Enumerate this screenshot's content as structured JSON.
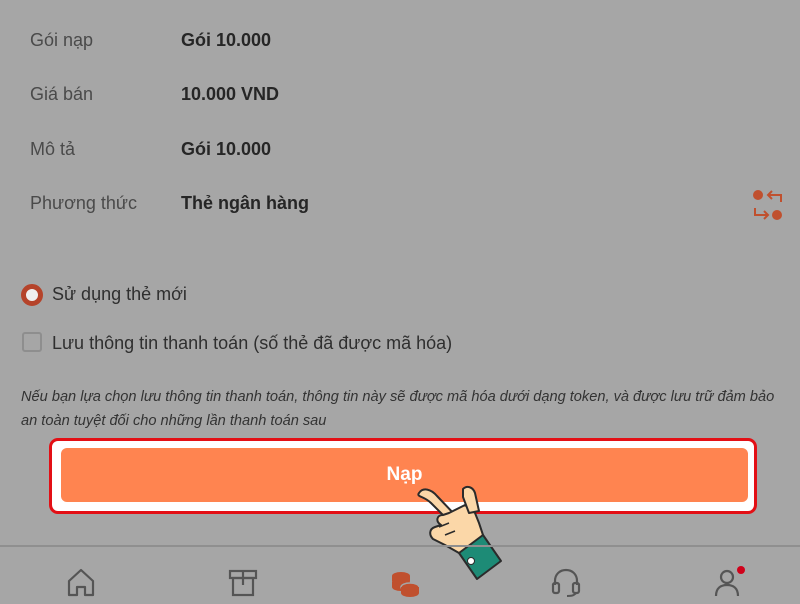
{
  "details": [
    {
      "label": "Gói nạp",
      "value": "Gói 10.000"
    },
    {
      "label": "Giá bán",
      "value": "10.000 VND"
    },
    {
      "label": "Mô tả",
      "value": "Gói 10.000"
    },
    {
      "label": "Phương thức",
      "value": "Thẻ ngân hàng"
    }
  ],
  "change_method_icon": "swap-icon",
  "options": {
    "new_card_label": "Sử dụng thẻ mới",
    "new_card_selected": true,
    "save_info_label": "Lưu thông tin thanh toán (số thẻ đã được mã hóa)",
    "save_info_checked": false
  },
  "note": "Nếu bạn lựa chọn lưu thông tin thanh toán, thông tin này sẽ được mã hóa dưới dạng token, và được lưu trữ đảm bảo an toàn tuyệt đối cho những lần thanh toán sau",
  "submit_label": "Nạp",
  "colors": {
    "accent": "#ff8450",
    "highlight_border": "#e30f15",
    "icon": "#c0502e",
    "notification_dot": "#d0021b"
  },
  "bottom_nav": [
    {
      "icon": "home-icon"
    },
    {
      "icon": "box-icon"
    },
    {
      "icon": "coins-icon",
      "active": true
    },
    {
      "icon": "headset-icon"
    },
    {
      "icon": "user-icon",
      "badge": true
    }
  ]
}
